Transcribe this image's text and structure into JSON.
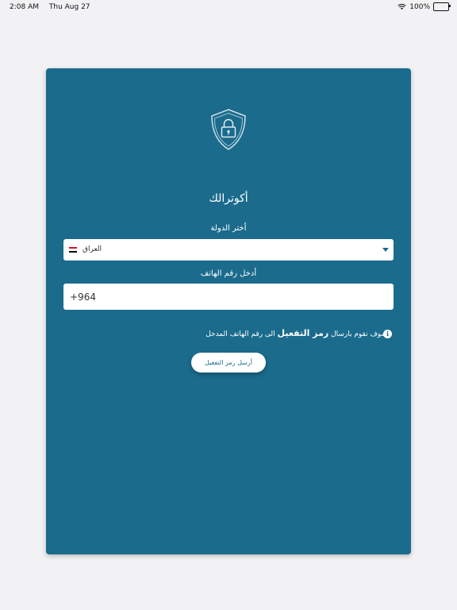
{
  "statusbar": {
    "time": "2:08 AM",
    "date": "Thu Aug 27",
    "battery": "100%"
  },
  "card": {
    "title": "أكوترالك",
    "country_label": "أختر الدولة",
    "country_value": "العراق",
    "phone_label": "أدخل رقم الهاتف",
    "phone_value": "+964",
    "info_pre": "سوف نقوم بارسال",
    "info_bold": "رمز التفعيل",
    "info_post": "الى رقم الهاتف المدخل",
    "send_label": "أرسل رمز التفعيل"
  },
  "colors": {
    "card": "#1b6b8d",
    "background": "#f2f2f4"
  },
  "icons": {
    "shield": "shield-lock-icon",
    "info": "info-icon",
    "dropdown": "chevron-down-icon"
  }
}
